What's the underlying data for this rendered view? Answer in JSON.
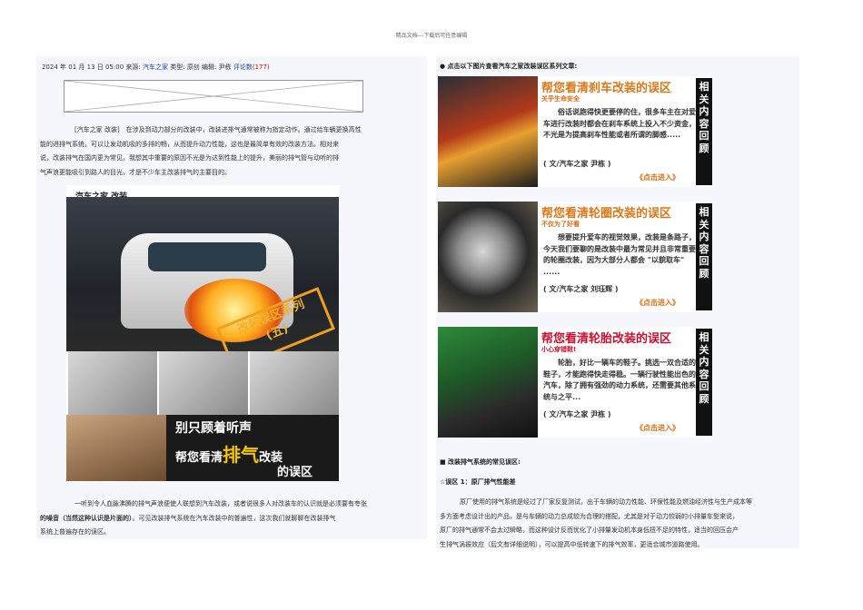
{
  "header_note": "精品文档---下载后可任意编辑",
  "meta": {
    "datetime": "2024 年 01 月 13 日 05:00",
    "source_label": "来源:",
    "source": "汽车之家",
    "type_label": "类型:",
    "type": "原创",
    "editor_label": "编辑:",
    "editor": "尹栋",
    "comments": "评论数",
    "comment_count": "(177)"
  },
  "intro": {
    "line1": "[汽车之家 改装]　在涉及到动力部分的改装中，改装进排气通常被称为指定动作。通过给车辆更换高性",
    "line2": "能的进排气系统，可以让发动机吸的多排的畅，从而提升动力性能，这也是最简单有效的改装方法。相对来",
    "line3": "说，改装排气在国内更为常见，我想其中重要的原因不光是为达到性能上的提升，美丽的排气管与动听的排",
    "line4": "气声浪更能吸引到路人的目光，才是不少车主改装排气的主要目的。"
  },
  "figure": {
    "header": "汽车之家 改装",
    "stamp_line1": "改装误区系列",
    "stamp_line2": "(五)",
    "caption_line1": "别只顾着听声",
    "caption_prefix": "帮您看清",
    "caption_big": "排气",
    "caption_suffix": "改装",
    "caption_line3": "的误区"
  },
  "outro": {
    "line1": "一听到令人血脉沸腾的排气声浪便使人联想到汽车改装，或者说很多人对改装车的认识就是必须要有夸张",
    "line2_pre": "的噪音（当然这种认识是片面的）",
    "line2_post": "。可见改装排气系统在汽车改装中的普遍性，这次我们就聊聊在改装排气",
    "line3": "系统上普遍存在的误区。"
  },
  "right": {
    "heading": "● 点击以下图片查看汽车之家改装误区系列文章:",
    "side_label": "相关内容回顾",
    "enter_label": "《点击进入》",
    "cards": [
      {
        "title": "帮您看清刹车改装的误区",
        "subtitle": "关乎生命安全",
        "body": "俗话说跑得快更要停的住，很多车主在对爱车进行改装时都会在刹车系统上投入不少资金，不光是为提高刹车性能或者所谓的脚感.....",
        "author": "( 文/汽车之家 尹栋 )"
      },
      {
        "title": "帮您看清轮圈改装的误区",
        "subtitle": "不仅为了好看",
        "body": "想要提升爱车的视觉效果，改装是条路子，今天我们要聊的是改装中最为常见并且非常重要的轮圈改装，因为大部分人都会 \"以貌取车\" ......",
        "author": "( 文/汽车之家 刘珏辉 )"
      },
      {
        "title": "帮您看清轮胎改装的误区",
        "subtitle": "小心穿错鞋!",
        "body": "轮胎，好比一辆车的鞋子。挑选一双合适的鞋子，才能跑得快走得稳。一辆行驶性能出色的汽车，除了拥有强劲的动力系统，还需要其他系统与之平...",
        "author": "( 文/汽车之家 尹栋 )"
      }
    ],
    "section_title": "■ 改装排气系统的常见误区:",
    "misconception_title": "☆误区 1：原厂排气性能差",
    "para1": "原厂使用的排气系统是经过了厂家反复测试，出于车辆的动力性能、环保性能及燃油经济性与生产成本等",
    "para2": "多方面考虑设计出的产品，是与车辆的动力总成较为合理的搭配，尤其是对于动力较弱的小排量车型来说，",
    "para3": "原厂的排气通常不会太过瞬略，而这种设计反而优化了小排量发动机本身低扭不足的特性，适当的回压会产",
    "para4": "生排气涡振效应（后文有详细说明），可以提高中低转速下的排气效率，更适合城市道路使用。"
  },
  "colors": {
    "link": "#1a3ea8",
    "count": "#cc0000",
    "title_orange": "#d9781a",
    "accent_orange": "#e06a10",
    "panel_bg": "#f5f7fc"
  }
}
